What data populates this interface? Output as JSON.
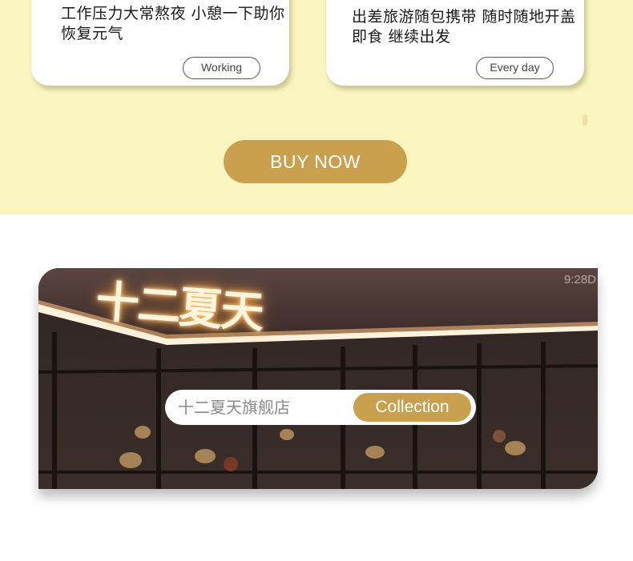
{
  "cards": [
    {
      "text": "工作压力大常熬夜 小憩一下助你恢复元气",
      "tag": "Working"
    },
    {
      "text": "出差旅游随包携带 随时随地开盖即食 继续出发",
      "tag": "Every day"
    }
  ],
  "buy_button": {
    "label": "BUY NOW"
  },
  "store": {
    "sign": "十二夏天",
    "number": "9:28D",
    "search_text": "十二夏天旗舰店",
    "collection_label": "Collection"
  },
  "colors": {
    "top_background": "#faf5c0",
    "accent": "#c9a04e"
  }
}
